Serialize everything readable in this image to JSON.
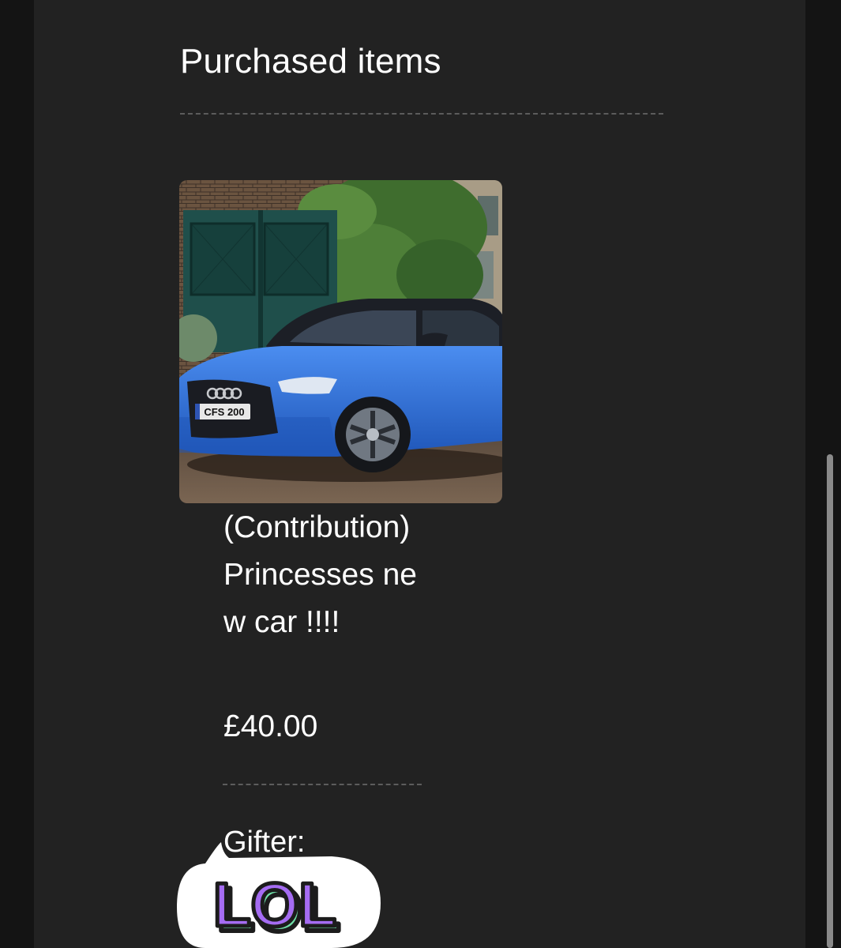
{
  "section": {
    "title": "Purchased items"
  },
  "item": {
    "image_icon": "car-photo",
    "image_alt": "Blue hatchback car parked on a cobbled street",
    "plate_text": "CFS 200",
    "name": "(Contribution) Princesses new car !!!!",
    "price": "£40.00"
  },
  "gifter": {
    "label": "Gifter:",
    "sticker_text": "LOL"
  },
  "colors": {
    "background": "#141414",
    "panel": "#222222",
    "text": "#ffffff",
    "divider": "#5c5c5c",
    "car_blue": "#2d6fd6",
    "sticker_purple": "#a56cf2",
    "sticker_green": "#6fe0a8"
  }
}
